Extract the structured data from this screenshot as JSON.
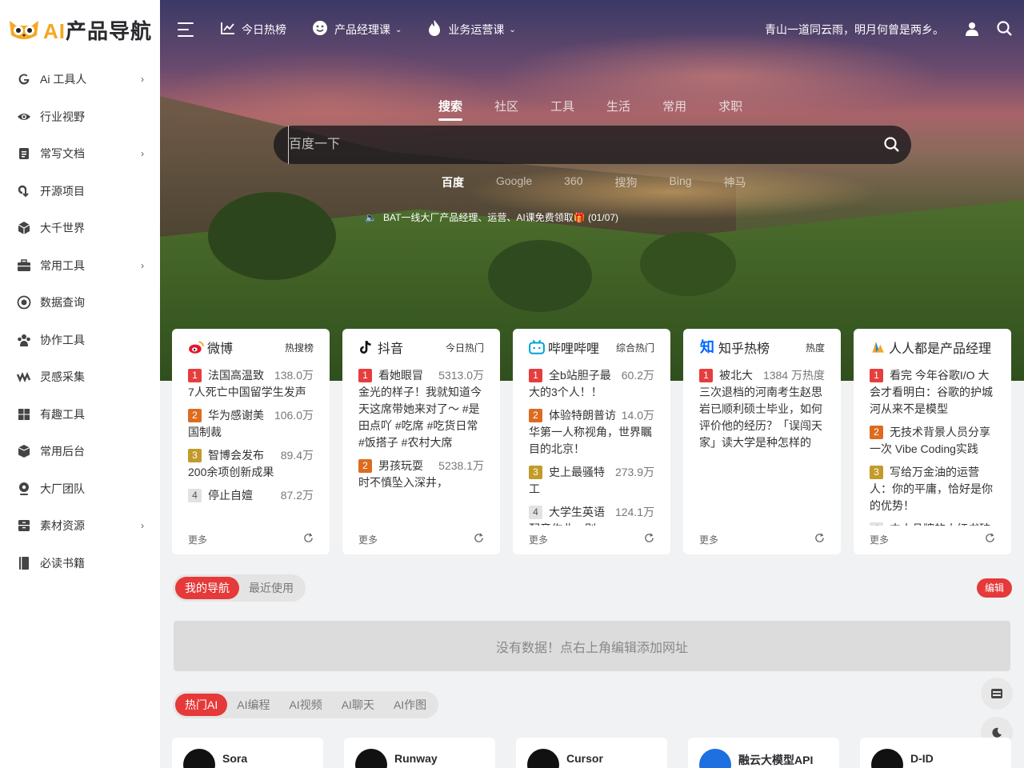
{
  "logo": {
    "text_ai": "AI",
    "text_rest": "产品导航"
  },
  "sidebar": {
    "items": [
      {
        "label": "Ai 工具人",
        "icon": "google-icon",
        "has_children": true
      },
      {
        "label": "行业视野",
        "icon": "eye-icon",
        "has_children": false
      },
      {
        "label": "常写文档",
        "icon": "document-icon",
        "has_children": true
      },
      {
        "label": "开源项目",
        "icon": "link-icon",
        "has_children": false
      },
      {
        "label": "大千世界",
        "icon": "cube-icon",
        "has_children": false
      },
      {
        "label": "常用工具",
        "icon": "toolbox-icon",
        "has_children": true
      },
      {
        "label": "数据查询",
        "icon": "target-icon",
        "has_children": false
      },
      {
        "label": "协作工具",
        "icon": "team-icon",
        "has_children": false
      },
      {
        "label": "灵感采集",
        "icon": "wave-icon",
        "has_children": false
      },
      {
        "label": "有趣工具",
        "icon": "windows-icon",
        "has_children": false
      },
      {
        "label": "常用后台",
        "icon": "box-icon",
        "has_children": false
      },
      {
        "label": "大厂团队",
        "icon": "location-icon",
        "has_children": false
      },
      {
        "label": "素材资源",
        "icon": "archive-icon",
        "has_children": true
      },
      {
        "label": "必读书籍",
        "icon": "book-icon",
        "has_children": false
      }
    ]
  },
  "topbar": {
    "links": [
      {
        "label": "今日热榜",
        "icon": "chart-line-icon",
        "dropdown": false
      },
      {
        "label": "产品经理课",
        "icon": "smile-icon",
        "dropdown": true
      },
      {
        "label": "业务运营课",
        "icon": "fire-icon",
        "dropdown": true
      }
    ],
    "quote": "青山一道同云雨，明月何曾是两乡。"
  },
  "search": {
    "tabs": [
      "搜索",
      "社区",
      "工具",
      "生活",
      "常用",
      "求职"
    ],
    "active_tab": 0,
    "placeholder": "百度一下",
    "engines": [
      "百度",
      "Google",
      "360",
      "搜狗",
      "Bing",
      "神马"
    ],
    "active_engine": 0,
    "notice": "BAT一线大厂产品经理、运营、AI课免费领取🎁 (01/07)"
  },
  "hot_cards": [
    {
      "title": "微博",
      "sub": "热搜榜",
      "icon": "weibo-icon",
      "items": [
        {
          "rank": "1",
          "text": "法国高温致7人死亡中国留学生发声",
          "heat": "138.0万"
        },
        {
          "rank": "2",
          "text": "华为感谢美国制裁",
          "heat": "106.0万"
        },
        {
          "rank": "3",
          "text": "智博会发布200余项创新成果",
          "heat": "89.4万"
        },
        {
          "rank": "4",
          "text": "停止自嬗",
          "heat": "87.2万"
        }
      ],
      "more": "更多"
    },
    {
      "title": "抖音",
      "sub": "今日热门",
      "icon": "douyin-icon",
      "items": [
        {
          "rank": "1",
          "text": "看她眼冒金光的样子！我就知道今天这席带她来对了～ #是田点吖 #吃席 #吃货日常#饭搭子 #农村大席",
          "heat": "5313.0万"
        },
        {
          "rank": "2",
          "text": "男孩玩耍时不慎坠入深井，",
          "heat": "5238.1万"
        }
      ],
      "more": "更多"
    },
    {
      "title": "哔哩哔哩",
      "sub": "综合热门",
      "icon": "bilibili-icon",
      "items": [
        {
          "rank": "1",
          "text": "全b站胆子最大的3个人！！",
          "heat": "60.2万"
        },
        {
          "rank": "2",
          "text": "体验特朗普访华第一人称视角，世界瞩目的北京！",
          "heat": "14.0万"
        },
        {
          "rank": "3",
          "text": "史上最骚特工",
          "heat": "273.9万"
        },
        {
          "rank": "4",
          "text": "大学生英语配音作业，别",
          "heat": "124.1万"
        }
      ],
      "more": "更多"
    },
    {
      "title": "知乎热榜",
      "sub": "热度",
      "icon": "zhihu-icon",
      "items": [
        {
          "rank": "1",
          "text": "被北大三次退档的河南考生赵思岩已顺利硕士毕业，如何评价他的经历？「误闯天家」读大学是种怎样的",
          "heat": "1384 万热度"
        }
      ],
      "more": "更多"
    },
    {
      "title": "人人都是产品经理",
      "sub": "",
      "icon": "woshipm-icon",
      "items": [
        {
          "rank": "1",
          "text": "看完 今年谷歌I/O 大会才看明白：谷歌的护城河从来不是模型",
          "heat": ""
        },
        {
          "rank": "2",
          "text": "无技术背景人员分享一次 Vibe Coding实践",
          "heat": ""
        },
        {
          "rank": "3",
          "text": "写给万金油的运营人：你的平庸，恰好是你的优势！",
          "heat": ""
        },
        {
          "rank": "4",
          "text": "中小品牌的小红书破",
          "heat": ""
        }
      ],
      "more": "更多"
    }
  ],
  "my_nav": {
    "tabs": [
      "我的导航",
      "最近使用"
    ],
    "active_tab": 0,
    "edit_label": "编辑",
    "empty_text": "没有数据！点右上角编辑添加网址"
  },
  "ai_tabs": {
    "tabs": [
      "热门AI",
      "AI编程",
      "AI视频",
      "AI聊天",
      "AI作图"
    ],
    "active_tab": 0
  },
  "ai_tools": [
    {
      "name": "Sora",
      "logo": "openai-icon"
    },
    {
      "name": "Runway",
      "logo": "runway-icon"
    },
    {
      "name": "Cursor",
      "logo": "cursor-icon"
    },
    {
      "name": "融云大模型API",
      "logo": "rongcloud-icon"
    },
    {
      "name": "D-ID",
      "logo": "did-icon"
    }
  ],
  "colors": {
    "accent": "#e5393a",
    "logo_yellow": "#f5a623",
    "sidebar_bg": "#ffffff",
    "page_bg": "#f1f2f3"
  }
}
